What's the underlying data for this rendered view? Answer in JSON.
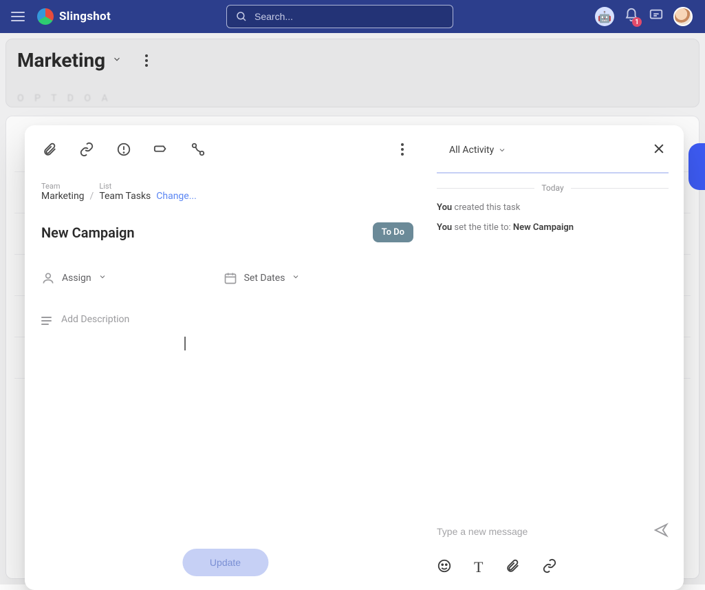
{
  "brand": {
    "name": "Slingshot"
  },
  "search": {
    "placeholder": "Search..."
  },
  "notifications": {
    "count": "1"
  },
  "page": {
    "title": "Marketing"
  },
  "modal": {
    "breadcrumb": {
      "team_label": "Team",
      "team_value": "Marketing",
      "list_label": "List",
      "list_value": "Team Tasks",
      "change": "Change..."
    },
    "task_title": "New Campaign",
    "status": "To Do",
    "assign_label": "Assign",
    "dates_label": "Set Dates",
    "description_placeholder": "Add Description",
    "update_button": "Update"
  },
  "activity": {
    "filter": "All Activity",
    "divider": "Today",
    "line1_actor": "You",
    "line1_rest": " created this task",
    "line2_actor": "You",
    "line2_rest": " set the title to: ",
    "line2_value": "New Campaign"
  },
  "compose": {
    "placeholder": "Type a new message"
  }
}
